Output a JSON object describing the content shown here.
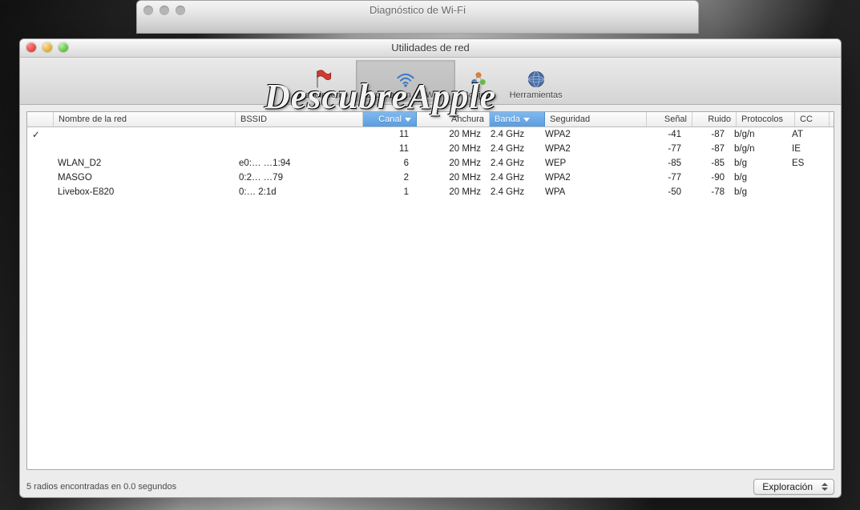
{
  "back_window": {
    "title": "Diagnóstico de Wi-Fi"
  },
  "window": {
    "title": "Utilidades de red"
  },
  "toolbar": {
    "items": [
      {
        "key": "rendimiento",
        "label": "Rendimiento",
        "active": false
      },
      {
        "key": "exploracion",
        "label": "Exploración de Wi-Fi",
        "active": true
      },
      {
        "key": "bonjour",
        "label": "Bonjour",
        "active": false
      },
      {
        "key": "herramientas",
        "label": "Herramientas",
        "active": false
      }
    ]
  },
  "columns": {
    "name": "Nombre de la red",
    "bssid": "BSSID",
    "canal": "Canal",
    "anch": "Anchura",
    "banda": "Banda",
    "seg": "Seguridad",
    "senal": "Señal",
    "ruido": "Ruido",
    "proto": "Protocolos",
    "cc": "CC"
  },
  "rows": [
    {
      "connected": true,
      "name": "",
      "bssid": "",
      "canal": "11",
      "anch": "20 MHz",
      "banda": "2.4 GHz",
      "seg": "WPA2",
      "senal": "-41",
      "ruido": "-87",
      "proto": "b/g/n",
      "cc": "AT"
    },
    {
      "connected": false,
      "name": "",
      "bssid": "",
      "canal": "11",
      "anch": "20 MHz",
      "banda": "2.4 GHz",
      "seg": "WPA2",
      "senal": "-77",
      "ruido": "-87",
      "proto": "b/g/n",
      "cc": "IE"
    },
    {
      "connected": false,
      "name": "WLAN_D2",
      "bssid": "e0:… …1:94",
      "canal": "6",
      "anch": "20 MHz",
      "banda": "2.4 GHz",
      "seg": "WEP",
      "senal": "-85",
      "ruido": "-85",
      "proto": "b/g",
      "cc": "ES"
    },
    {
      "connected": false,
      "name": "MASGO",
      "bssid": "0:2… …79",
      "canal": "2",
      "anch": "20 MHz",
      "banda": "2.4 GHz",
      "seg": "WPA2",
      "senal": "-77",
      "ruido": "-90",
      "proto": "b/g",
      "cc": ""
    },
    {
      "connected": false,
      "name": "Livebox-E820",
      "bssid": "0:… 2:1d",
      "canal": "1",
      "anch": "20 MHz",
      "banda": "2.4 GHz",
      "seg": "WPA",
      "senal": "-50",
      "ruido": "-78",
      "proto": "b/g",
      "cc": ""
    }
  ],
  "status": {
    "text": "5 radios encontradas en 0.0 segundos",
    "action_label": "Exploración"
  },
  "watermark": "DescubreApple"
}
